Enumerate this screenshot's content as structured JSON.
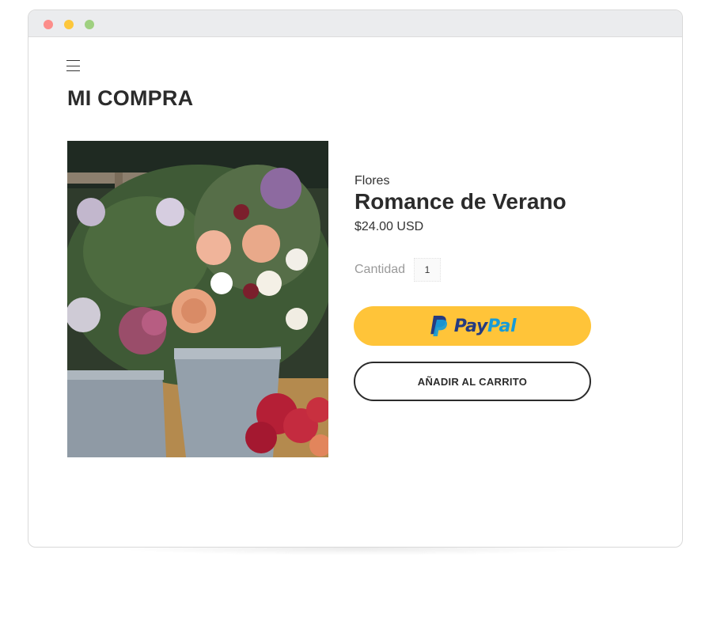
{
  "window": {
    "controls": [
      "close-dot",
      "minimize-dot",
      "maximize-dot"
    ]
  },
  "header": {
    "menu_icon": "hamburger-menu-icon",
    "title": "MI COMPRA"
  },
  "product": {
    "image_icon": "flower-bouquet-photo",
    "category": "Flores",
    "name": "Romance de Verano",
    "price": "$24.00 USD"
  },
  "quantity": {
    "label": "Cantidad",
    "value": "1"
  },
  "paypal": {
    "icon": "paypal-p-icon",
    "label_pay": "Pay",
    "label_pal": "Pal"
  },
  "cart": {
    "label": "AÑADIR AL CARRITO"
  },
  "colors": {
    "paypal_yellow": "#ffc439",
    "paypal_dark_blue": "#253b80",
    "paypal_light_blue": "#179bd7",
    "text_dark": "#2b2b2b"
  }
}
